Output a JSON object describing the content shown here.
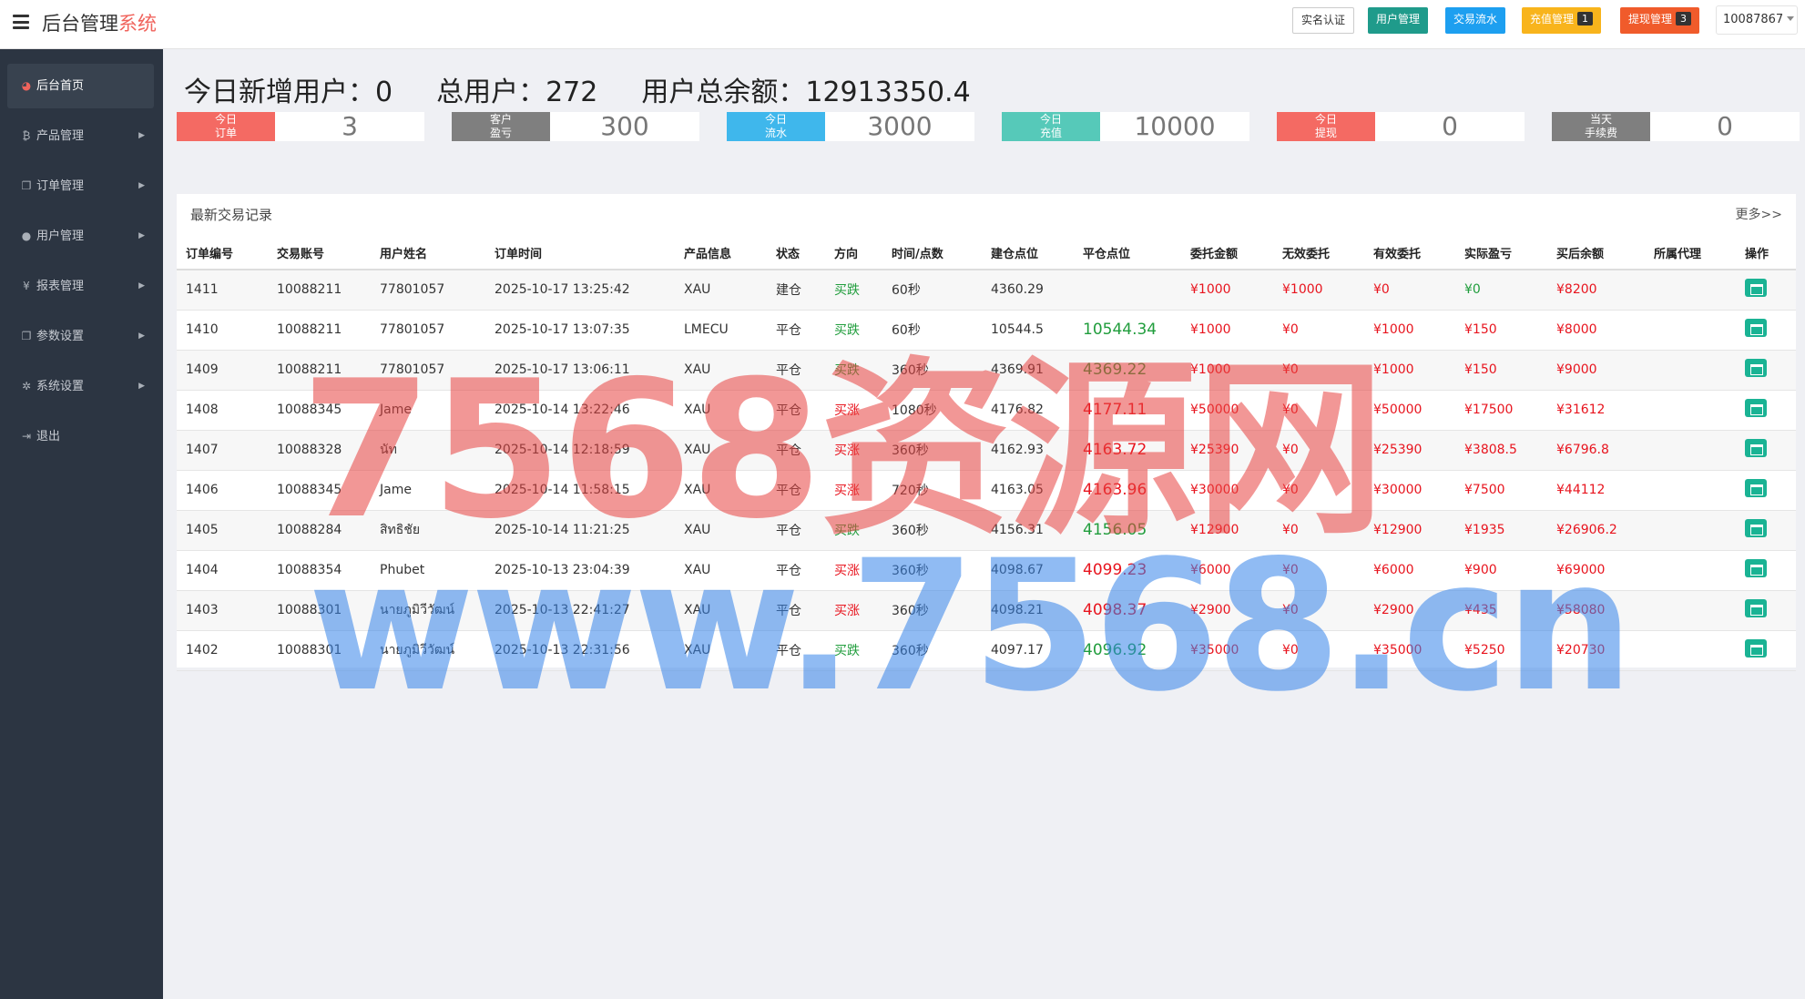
{
  "brand": {
    "title": "后台管理",
    "accent": "系统"
  },
  "topbar": {
    "verify_label": "实名认证",
    "users_label": "用户管理",
    "trades_label": "交易流水",
    "recharge_label": "充值管理",
    "recharge_badge": "1",
    "withdraw_label": "提现管理",
    "withdraw_badge": "3",
    "account": "10087867"
  },
  "sidebar": {
    "items": [
      {
        "label": "后台首页",
        "icon": "dashboard-icon"
      },
      {
        "label": "产品管理",
        "icon": "bitcoin-icon"
      },
      {
        "label": "订单管理",
        "icon": "copy-icon"
      },
      {
        "label": "用户管理",
        "icon": "user-icon"
      },
      {
        "label": "报表管理",
        "icon": "yen-icon"
      },
      {
        "label": "参数设置",
        "icon": "copy-icon"
      },
      {
        "label": "系统设置",
        "icon": "gears-icon"
      },
      {
        "label": "退出",
        "icon": "sign-out-icon"
      }
    ]
  },
  "summary": {
    "new_users": "今日新增用户：0",
    "total_users": "总用户：272",
    "total_balance": "用户总余额：12913350.4"
  },
  "stats": [
    {
      "line1": "今日",
      "line2": "订单",
      "value": "3",
      "color": "#f46a63"
    },
    {
      "line1": "客户",
      "line2": "盈亏",
      "value": "300",
      "color": "#7f7f7f"
    },
    {
      "line1": "今日",
      "line2": "流水",
      "value": "3000",
      "color": "#3fb7ec"
    },
    {
      "line1": "今日",
      "line2": "充值",
      "value": "10000",
      "color": "#56c9b9"
    },
    {
      "line1": "今日",
      "line2": "提现",
      "value": "0",
      "color": "#f46a63"
    },
    {
      "line1": "当天",
      "line2": "手续费",
      "value": "0",
      "color": "#7f7f7f"
    }
  ],
  "table": {
    "title": "最新交易记录",
    "more": "更多>>",
    "headers": [
      "订单编号",
      "交易账号",
      "用户姓名",
      "订单时间",
      "产品信息",
      "状态",
      "方向",
      "时间/点数",
      "建仓点位",
      "平仓点位",
      "委托金额",
      "无效委托",
      "有效委托",
      "实际盈亏",
      "买后余额",
      "所属代理",
      "操作"
    ],
    "rows": [
      [
        "1411",
        "10088211",
        "77801057",
        "2025-10-17 13:25:42",
        "XAU",
        "建仓",
        "买跌",
        "60秒",
        "4360.29",
        "",
        "¥1000",
        "¥1000",
        "¥0",
        "¥0",
        "¥8200",
        ""
      ],
      [
        "1410",
        "10088211",
        "77801057",
        "2025-10-17 13:07:35",
        "LMECU",
        "平仓",
        "买跌",
        "60秒",
        "10544.5",
        "10544.34",
        "¥1000",
        "¥0",
        "¥1000",
        "¥150",
        "¥8000",
        ""
      ],
      [
        "1409",
        "10088211",
        "77801057",
        "2025-10-17 13:06:11",
        "XAU",
        "平仓",
        "买跌",
        "360秒",
        "4369.91",
        "4369.22",
        "¥1000",
        "¥0",
        "¥1000",
        "¥150",
        "¥9000",
        ""
      ],
      [
        "1408",
        "10088345",
        "Jame",
        "2025-10-14 13:22:46",
        "XAU",
        "平仓",
        "买涨",
        "1080秒",
        "4176.82",
        "4177.11",
        "¥50000",
        "¥0",
        "¥50000",
        "¥17500",
        "¥31612",
        ""
      ],
      [
        "1407",
        "10088328",
        "นัท",
        "2025-10-14 12:18:59",
        "XAU",
        "平仓",
        "买涨",
        "360秒",
        "4162.93",
        "4163.72",
        "¥25390",
        "¥0",
        "¥25390",
        "¥3808.5",
        "¥6796.8",
        ""
      ],
      [
        "1406",
        "10088345",
        "Jame",
        "2025-10-14 11:58:15",
        "XAU",
        "平仓",
        "买涨",
        "720秒",
        "4163.05",
        "4163.96",
        "¥30000",
        "¥0",
        "¥30000",
        "¥7500",
        "¥44112",
        ""
      ],
      [
        "1405",
        "10088284",
        "สิทธิชัย",
        "2025-10-14 11:21:25",
        "XAU",
        "平仓",
        "买跌",
        "360秒",
        "4156.31",
        "4156.05",
        "¥12900",
        "¥0",
        "¥12900",
        "¥1935",
        "¥26906.2",
        ""
      ],
      [
        "1404",
        "10088354",
        "Phubet",
        "2025-10-13 23:04:39",
        "XAU",
        "平仓",
        "买涨",
        "360秒",
        "4098.67",
        "4099.23",
        "¥6000",
        "¥0",
        "¥6000",
        "¥900",
        "¥69000",
        ""
      ],
      [
        "1403",
        "10088301",
        "นายภูมิวีวัฒน์",
        "2025-10-13 22:41:27",
        "XAU",
        "平仓",
        "买涨",
        "360秒",
        "4098.21",
        "4098.37",
        "¥2900",
        "¥0",
        "¥2900",
        "¥435",
        "¥58080",
        ""
      ],
      [
        "1402",
        "10088301",
        "นายภูมิวีวัฒน์",
        "2025-10-13 22:31:56",
        "XAU",
        "平仓",
        "买跌",
        "360秒",
        "4097.17",
        "4096.92",
        "¥35000",
        "¥0",
        "¥35000",
        "¥5250",
        "¥20730",
        ""
      ]
    ]
  },
  "watermark": {
    "line1": "7568资源网",
    "line2": "www.7568.cn"
  }
}
